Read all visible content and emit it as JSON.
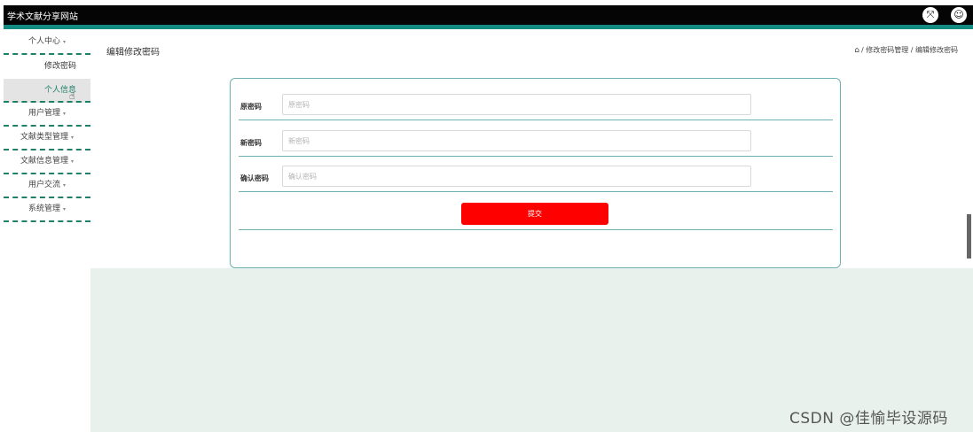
{
  "header": {
    "site_title": "学术文献分享网站",
    "expand_icon_glyph": "⤧",
    "user_icon_glyph": "☺"
  },
  "colors": {
    "header_bg": "#050505",
    "accent": "#138a82",
    "submit": "#ff0000",
    "content_bg": "#e9f1ed"
  },
  "sidebar": {
    "caret_glyph": "▾",
    "items": [
      {
        "label": "个人中心",
        "children": [
          "修改密码",
          "个人信息"
        ]
      },
      {
        "label": "用户管理"
      },
      {
        "label": "文献类型管理"
      },
      {
        "label": "文献信息管理"
      },
      {
        "label": "用户交流"
      },
      {
        "label": "系统管理"
      }
    ]
  },
  "main": {
    "page_title": "编辑修改密码",
    "breadcrumb": {
      "home_glyph": "⌂",
      "text": "/ 修改密码管理 / 编辑修改密码"
    },
    "form": {
      "fields": [
        {
          "label": "原密码",
          "placeholder": "原密码",
          "value": ""
        },
        {
          "label": "新密码",
          "placeholder": "新密码",
          "value": ""
        },
        {
          "label": "确认密码",
          "placeholder": "确认密码",
          "value": ""
        }
      ],
      "submit_label": "提交"
    }
  },
  "watermark": "CSDN @佳愉毕设源码"
}
